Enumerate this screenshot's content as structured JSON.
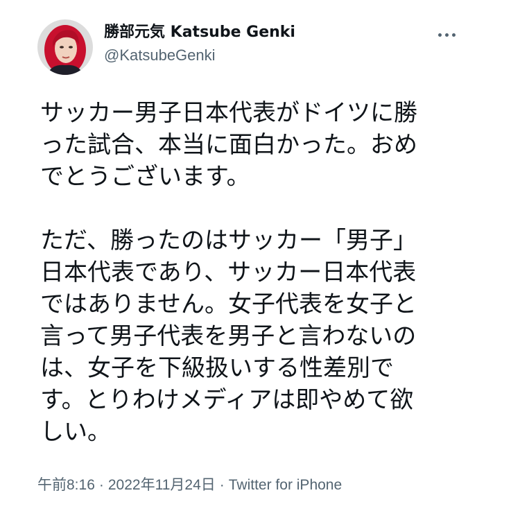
{
  "author": {
    "display_name": "勝部元気 Katsube Genki",
    "handle": "@KatsubeGenki"
  },
  "more_icon": "more-horizontal-icon",
  "tweet": {
    "paragraphs": [
      "サッカー男子日本代表がドイツに勝\nった試合、本当に面白かった。おめ\nでとうございます。",
      "ただ、勝ったのはサッカー「男子」\n日本代表であり、サッカー日本代表\nではありません。女子代表を女子と\n言って男子代表を男子と言わないの\nは、女子を下級扱いする性差別で\nす。とりわけメディアは即やめて欲\nしい。"
    ]
  },
  "meta": {
    "time": "午前8:16",
    "separator": "·",
    "date": "2022年11月24日",
    "source": "Twitter for iPhone"
  },
  "colors": {
    "text": "#0f1419",
    "secondary": "#536471",
    "avatar_hair": "#c8102e"
  }
}
